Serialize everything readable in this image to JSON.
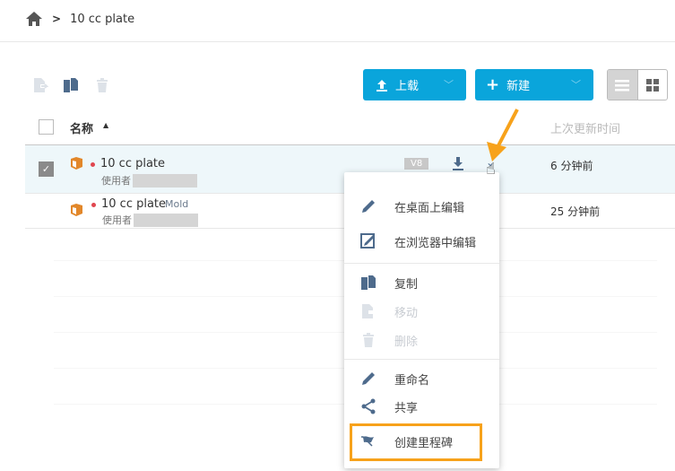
{
  "breadcrumb": {
    "current": "10 cc plate"
  },
  "toolbar": {
    "upload_label": "上载",
    "new_label": "新建"
  },
  "table": {
    "col_name": "名称",
    "col_updated": "上次更新时间",
    "rows": [
      {
        "name": "10 cc plate",
        "tag": "",
        "owner_prefix": "使用者",
        "version": "V8",
        "updated": "6 分钟前",
        "selected": true
      },
      {
        "name": "10 cc plate",
        "tag": "Mold",
        "owner_prefix": "使用者",
        "updated": "25 分钟前",
        "selected": false
      }
    ]
  },
  "menu": {
    "items": [
      {
        "label": "在桌面上编辑",
        "icon": "pencil-icon",
        "enabled": true
      },
      {
        "label": "在浏览器中编辑",
        "icon": "browser-edit-icon",
        "enabled": true
      },
      {
        "label": "复制",
        "icon": "copy-icon",
        "enabled": true
      },
      {
        "label": "移动",
        "icon": "move-icon",
        "enabled": false
      },
      {
        "label": "删除",
        "icon": "trash-icon",
        "enabled": false
      },
      {
        "label": "重命名",
        "icon": "pencil-icon",
        "enabled": true
      },
      {
        "label": "共享",
        "icon": "share-icon",
        "enabled": true
      },
      {
        "label": "创建里程碑",
        "icon": "flag-icon",
        "enabled": true
      }
    ]
  },
  "colors": {
    "accent": "#0aa5db",
    "highlight": "#f7a21b",
    "icon": "#4e6b8c"
  }
}
